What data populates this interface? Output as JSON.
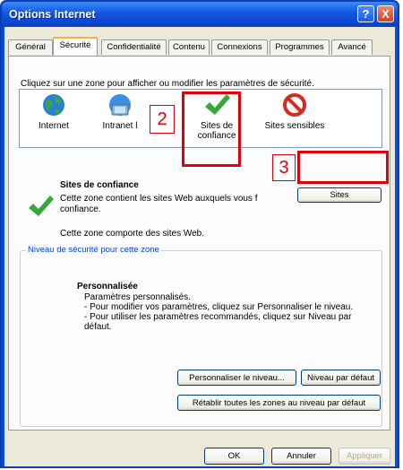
{
  "window": {
    "title": "Options Internet",
    "help_glyph": "?",
    "close_glyph": "X"
  },
  "tabs": [
    {
      "label": "Général"
    },
    {
      "label": "Sécurité"
    },
    {
      "label": "Confidentialité"
    },
    {
      "label": "Contenu"
    },
    {
      "label": "Connexions"
    },
    {
      "label": "Programmes"
    },
    {
      "label": "Avancé"
    }
  ],
  "security": {
    "instruction": "Cliquez sur une zone pour afficher ou modifier les paramètres de sécurité.",
    "zones": [
      {
        "label": "Internet",
        "icon": "globe-icon"
      },
      {
        "label": "Intranet l",
        "icon": "intranet-icon"
      },
      {
        "label_line1": "Sites de",
        "label_line2": "confiance",
        "icon": "checkmark-icon"
      },
      {
        "label": "Sites sensibles",
        "icon": "forbidden-icon"
      }
    ],
    "selected_zone_title": "Sites de confiance",
    "zone_desc_line1": "Cette zone contient les sites Web auxquels vous f",
    "zone_desc_line2": "confiance.",
    "zone_info": "Cette zone comporte des sites Web.",
    "sites_button": "Sites",
    "group_title": "Niveau de sécurité pour cette zone",
    "level_title": "Personnalisée",
    "level_desc_1": "Paramètres personnalisés.",
    "level_desc_2": "- Pour modifier vos paramètres, cliquez sur Personnaliser le niveau.",
    "level_desc_3": "- Pour utiliser les paramètres recommandés, cliquez sur Niveau par",
    "level_desc_4": "défaut.",
    "custom_level_button": "Personnaliser le niveau...",
    "default_level_button": "Niveau par défaut",
    "reset_all_button": "Rétablir toutes les zones au niveau par défaut"
  },
  "annotations": {
    "step2": "2",
    "step3": "3",
    "highlight_color": "#e0000a"
  },
  "footer": {
    "ok": "OK",
    "cancel": "Annuler",
    "apply": "Appliquer"
  }
}
